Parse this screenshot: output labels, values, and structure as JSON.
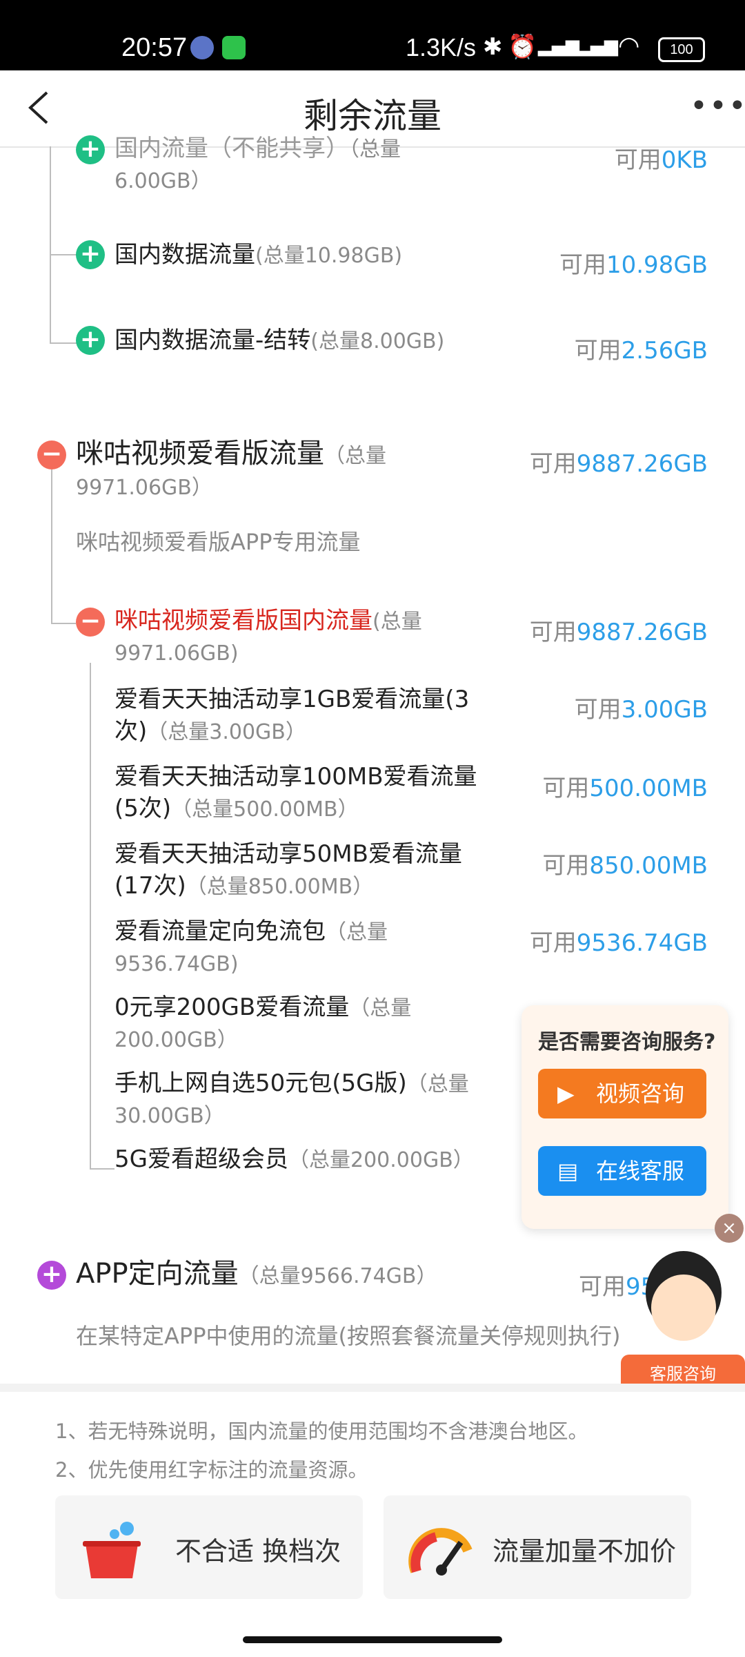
{
  "status_bar": {
    "time": "20:57",
    "speed": "1.3K/s",
    "battery": "100"
  },
  "header": {
    "title": "剩余流量",
    "back_label": "<",
    "more_label": "•••"
  },
  "partial_item": {
    "name": "国内流量（不能共享）",
    "total": "（总量",
    "total2": "6.00GB）",
    "avail_prefix": "可用",
    "avail_value": "0KB"
  },
  "items_group1": [
    {
      "name": "国内数据流量",
      "total": "(总量10.98GB)",
      "avail_prefix": "可用",
      "avail_value": "10.98GB"
    },
    {
      "name": "国内数据流量-结转",
      "total": "(总量8.00GB)",
      "avail_prefix": "可用",
      "avail_value": "2.56GB"
    }
  ],
  "migu": {
    "name": "咪咕视频爱看版流量",
    "total1": "（总量",
    "total2": "9971.06GB）",
    "avail_prefix": "可用",
    "avail_value": "9887.26GB",
    "desc": "咪咕视频爱看版APP专用流量",
    "sub": {
      "name": "咪咕视频爱看版国内流量",
      "total1": "(总量",
      "total2": "9971.06GB)",
      "avail_prefix": "可用",
      "avail_value": "9887.26GB"
    },
    "children": [
      {
        "line1": "爱看天天抽活动享1GB爱看流量(3",
        "line2": "次)",
        "total": "（总量3.00GB）",
        "avail_prefix": "可用",
        "avail_value": "3.00GB"
      },
      {
        "line1": "爱看天天抽活动享100MB爱看流量",
        "line2": "(5次)",
        "total": "（总量500.00MB）",
        "avail_prefix": "可用",
        "avail_value": "500.00MB"
      },
      {
        "line1": "爱看天天抽活动享50MB爱看流量",
        "line2": "(17次)",
        "total": "（总量850.00MB）",
        "avail_prefix": "可用",
        "avail_value": "850.00MB"
      },
      {
        "line1": "爱看流量定向免流包",
        "line1b": "（总量",
        "line2": "9536.74GB)",
        "avail_prefix": "可用",
        "avail_value": "9536.74GB"
      },
      {
        "line1": "0元享200GB爱看流量",
        "line1b": "（总量",
        "line2": "200.00GB）"
      },
      {
        "line1": "手机上网自选50元包(5G版)",
        "line1b": "（总量",
        "line2": "30.00GB）"
      },
      {
        "line1": "5G爱看超级会员",
        "line1b": "（总量200.00GB）"
      }
    ]
  },
  "app_flow": {
    "name": "APP定向流量",
    "total": "（总量9566.74GB）",
    "avail_prefix": "可用",
    "avail_value": "9566.7",
    "desc": "在某特定APP中使用的流量(按照套餐流量关停规则执行)"
  },
  "notes": [
    "1、若无特殊说明，国内流量的使用范围均不含港澳台地区。",
    "2、优先使用红字标注的流量资源。"
  ],
  "cards": [
    {
      "label": "不合适 换档次"
    },
    {
      "label": "流量加量不加价"
    }
  ],
  "popup": {
    "question": "是否需要咨询服务?",
    "video_btn": "视频咨询",
    "online_btn": "在线客服",
    "close": "×",
    "avatar_label": "客服咨询"
  },
  "colors": {
    "accent_blue": "#2c9ee8",
    "red_text": "#d8261e",
    "green": "#1fbf85",
    "orange_btn": "#f47a20",
    "blue_btn": "#1a8ff0"
  }
}
